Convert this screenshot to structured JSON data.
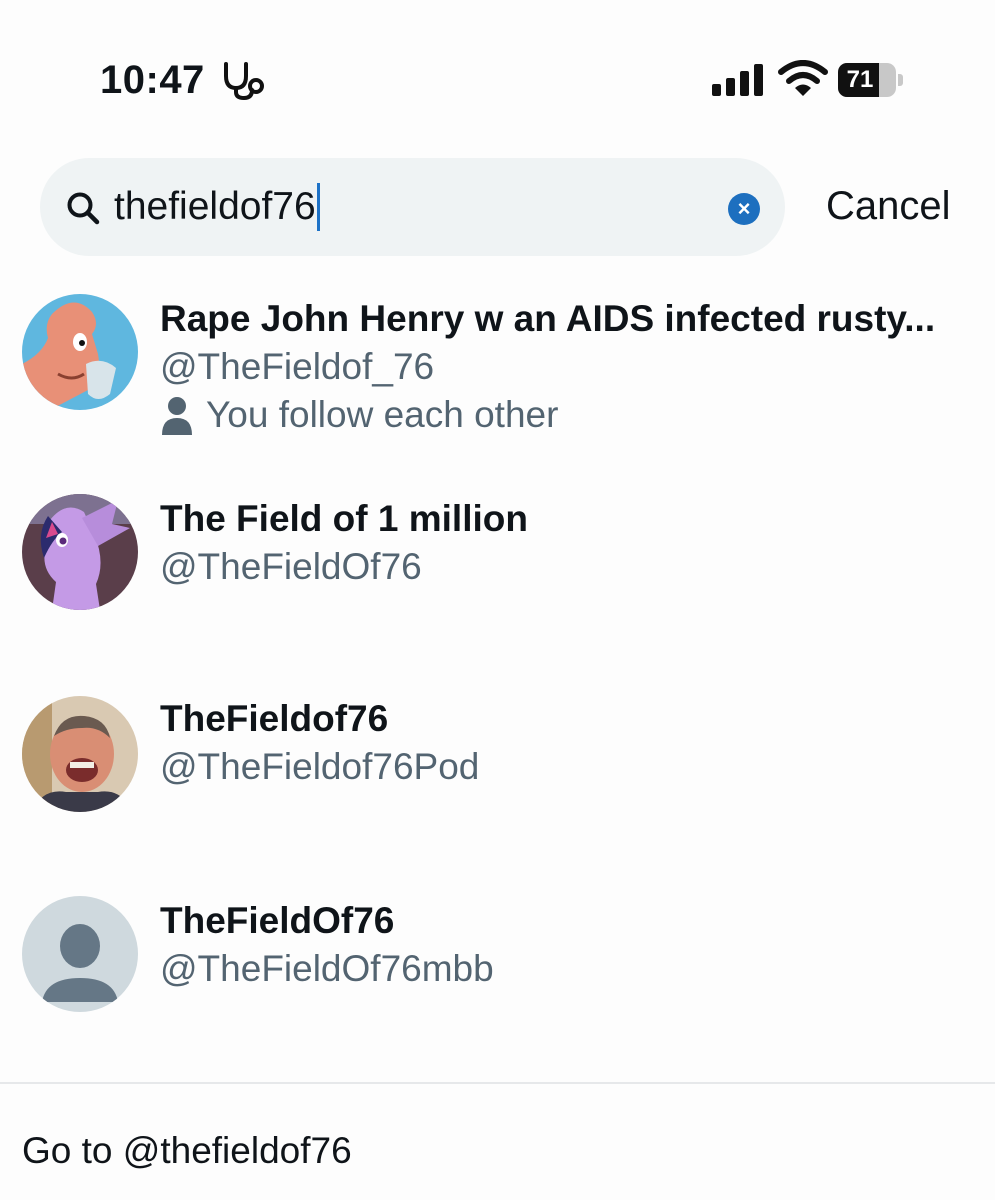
{
  "status_bar": {
    "time": "10:47",
    "battery": "71",
    "battery_level": 0.71
  },
  "search": {
    "query": "thefieldof76",
    "clear_label": "×",
    "cancel_label": "Cancel"
  },
  "results": [
    {
      "name": "Rape John Henry w an AIDS infected rusty...",
      "handle": "@TheFieldof_76",
      "follow_status": "You follow each other"
    },
    {
      "name": "The Field of 1 million",
      "handle": "@TheFieldOf76"
    },
    {
      "name": "TheFieldof76",
      "handle": "@TheFieldof76Pod"
    },
    {
      "name": "TheFieldOf76",
      "handle": "@TheFieldOf76mbb"
    }
  ],
  "goto": {
    "label": "Go to @thefieldof76"
  },
  "colors": {
    "accent": "#1d6fbf",
    "secondary_text": "#536471",
    "search_bg": "#eff3f4"
  }
}
